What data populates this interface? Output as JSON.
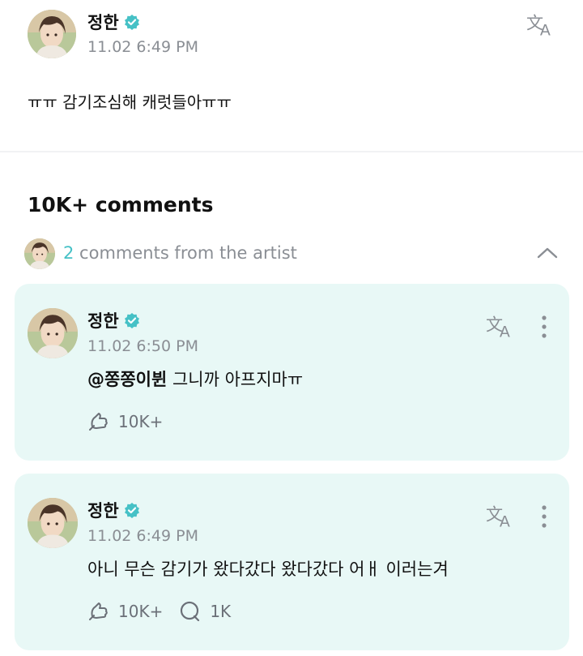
{
  "post": {
    "author": "정한",
    "time": "11.02 6:49 PM",
    "body": "ㅠㅠ 감기조심해 캐럿들아ㅠㅠ",
    "translate_icon": "translate-icon"
  },
  "comments": {
    "title": "10K+ comments",
    "artist_count": "2",
    "artist_label": " comments from the artist"
  },
  "replies": [
    {
      "author": "정한",
      "time": "11.02 6:50 PM",
      "mention": "@쫑쫑이뷘",
      "text": " 그니까 아프지마ㅠ",
      "likes": "10K+"
    },
    {
      "author": "정한",
      "time": "11.02 6:49 PM",
      "mention": "",
      "text": "아니 무슨 감기가 왔다갔다 왔다갔다 어ㅐ 이러는겨",
      "likes": "10K+",
      "replies": "1K"
    }
  ],
  "colors": {
    "accent": "#46c1c6",
    "card_bg": "#e8f8f6",
    "muted": "#8a8e94"
  }
}
